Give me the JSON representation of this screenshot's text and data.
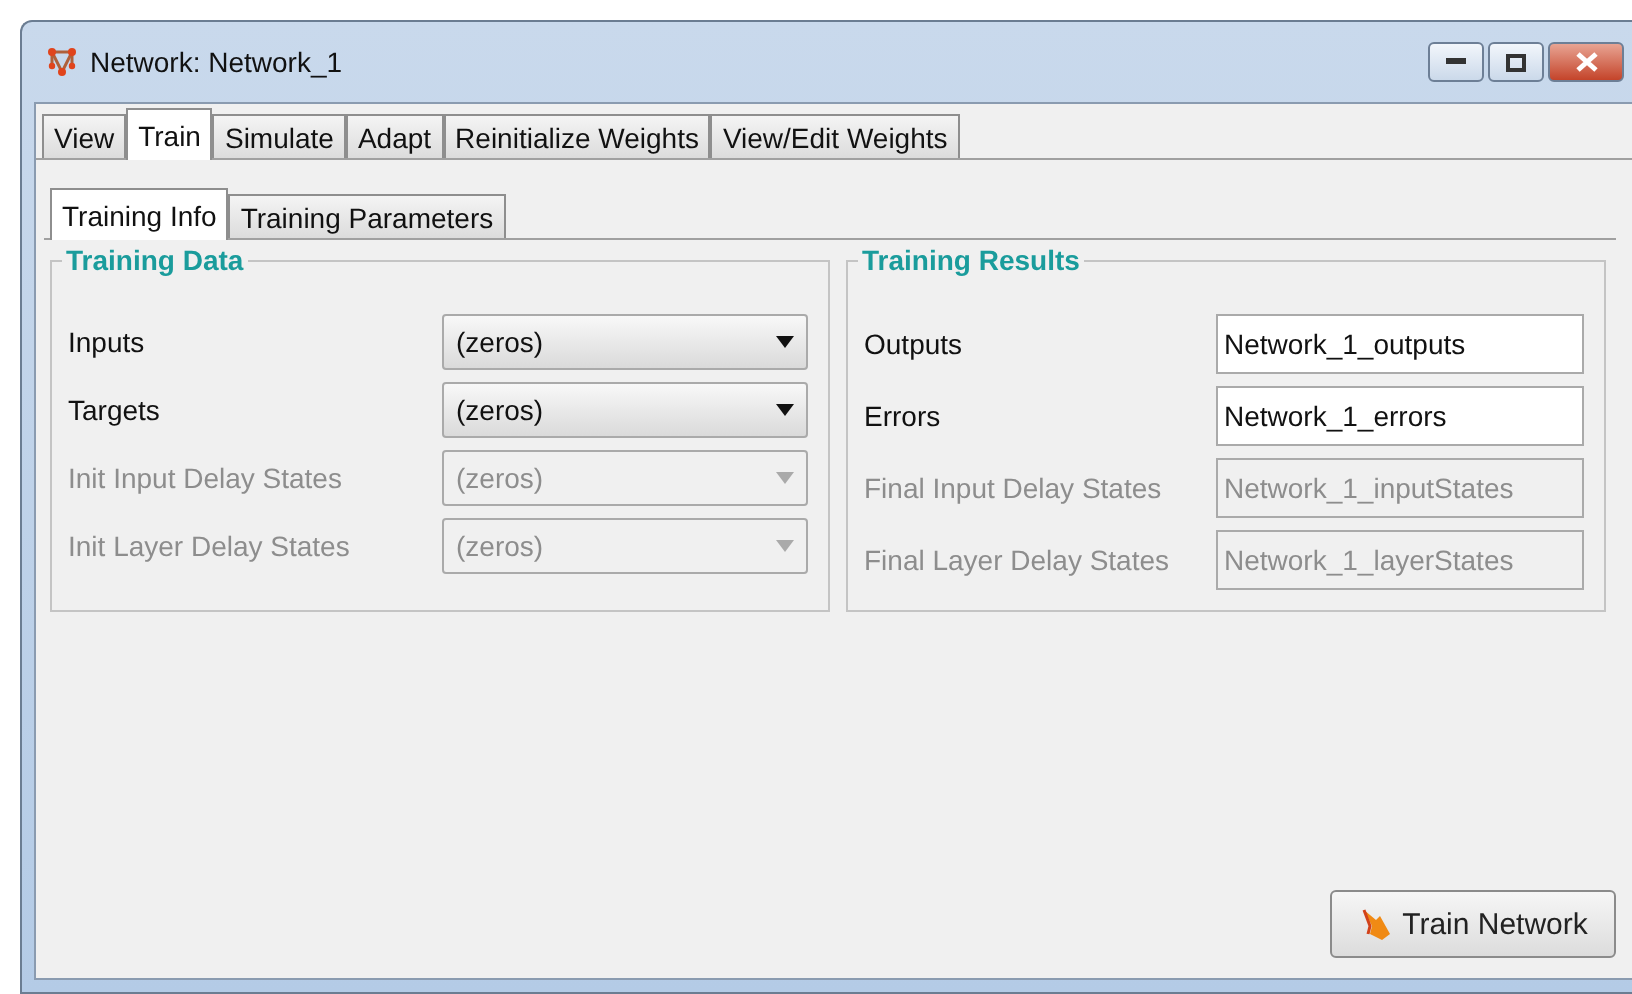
{
  "window": {
    "title": "Network: Network_1"
  },
  "tabs": [
    {
      "label": "View",
      "selected": false
    },
    {
      "label": "Train",
      "selected": true
    },
    {
      "label": "Simulate",
      "selected": false
    },
    {
      "label": "Adapt",
      "selected": false
    },
    {
      "label": "Reinitialize Weights",
      "selected": false
    },
    {
      "label": "View/Edit Weights",
      "selected": false
    }
  ],
  "subtabs": [
    {
      "label": "Training Info",
      "selected": true
    },
    {
      "label": "Training Parameters",
      "selected": false
    }
  ],
  "training_data": {
    "title": "Training Data",
    "rows": [
      {
        "label": "Inputs",
        "value": "(zeros)",
        "disabled": false
      },
      {
        "label": "Targets",
        "value": "(zeros)",
        "disabled": false
      },
      {
        "label": "Init Input Delay States",
        "value": "(zeros)",
        "disabled": true
      },
      {
        "label": "Init Layer Delay States",
        "value": "(zeros)",
        "disabled": true
      }
    ]
  },
  "training_results": {
    "title": "Training Results",
    "rows": [
      {
        "label": "Outputs",
        "value": "Network_1_outputs",
        "disabled": false
      },
      {
        "label": "Errors",
        "value": "Network_1_errors",
        "disabled": false
      },
      {
        "label": "Final Input Delay States",
        "value": "Network_1_inputStates",
        "disabled": true
      },
      {
        "label": "Final Layer Delay States",
        "value": "Network_1_layerStates",
        "disabled": true
      }
    ]
  },
  "train_button": {
    "label": "Train Network"
  }
}
